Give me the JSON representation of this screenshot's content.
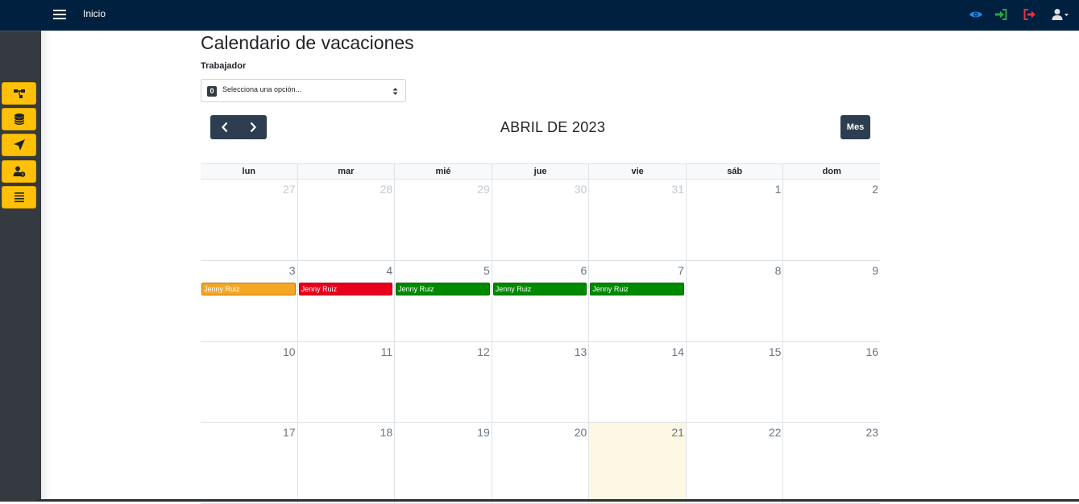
{
  "topbar": {
    "menu_icon": "hamburger-icon",
    "title": "Inicio",
    "icons": [
      {
        "name": "eye-icon",
        "color": "#1e88e5"
      },
      {
        "name": "sign-in-icon",
        "color": "#28a745"
      },
      {
        "name": "sign-out-icon",
        "color": "#dc3545"
      },
      {
        "name": "user-dropdown-icon",
        "color": "#e0e0e0"
      }
    ]
  },
  "sidebar": {
    "accent": "#ffc107",
    "items": [
      {
        "icon": "sitemap-icon"
      },
      {
        "icon": "database-icon"
      },
      {
        "icon": "location-arrow-icon"
      },
      {
        "icon": "user-clock-icon"
      },
      {
        "icon": "list-icon"
      }
    ]
  },
  "page": {
    "title": "Calendario de vacaciones",
    "field_label": "Trabajador",
    "select": {
      "badge": "0",
      "placeholder": "Selecciona una opción..."
    }
  },
  "calendar": {
    "title": "ABRIL DE 2023",
    "view_button": "Mes",
    "weekdays": [
      "lun",
      "mar",
      "mié",
      "jue",
      "vie",
      "sáb",
      "dom"
    ],
    "weeks": [
      {
        "days": [
          {
            "num": "27",
            "other": true
          },
          {
            "num": "28",
            "other": true
          },
          {
            "num": "29",
            "other": true
          },
          {
            "num": "30",
            "other": true
          },
          {
            "num": "31",
            "other": true
          },
          {
            "num": "1"
          },
          {
            "num": "2"
          }
        ]
      },
      {
        "days": [
          {
            "num": "3",
            "event": {
              "label": "Jenny Ruiz",
              "color": "#f5a623"
            }
          },
          {
            "num": "4",
            "event": {
              "label": "Jenny Ruiz",
              "color": "#e8001c"
            }
          },
          {
            "num": "5",
            "event": {
              "label": "Jenny Ruiz",
              "color": "#008a00"
            }
          },
          {
            "num": "6",
            "event": {
              "label": "Jenny Ruiz",
              "color": "#008a00"
            }
          },
          {
            "num": "7",
            "event": {
              "label": "Jenny Ruiz",
              "color": "#008a00"
            }
          },
          {
            "num": "8"
          },
          {
            "num": "9"
          }
        ]
      },
      {
        "days": [
          {
            "num": "10"
          },
          {
            "num": "11"
          },
          {
            "num": "12"
          },
          {
            "num": "13"
          },
          {
            "num": "14"
          },
          {
            "num": "15"
          },
          {
            "num": "16"
          }
        ]
      },
      {
        "days": [
          {
            "num": "17"
          },
          {
            "num": "18"
          },
          {
            "num": "19"
          },
          {
            "num": "20"
          },
          {
            "num": "21",
            "today": true
          },
          {
            "num": "22"
          },
          {
            "num": "23"
          }
        ]
      }
    ]
  }
}
